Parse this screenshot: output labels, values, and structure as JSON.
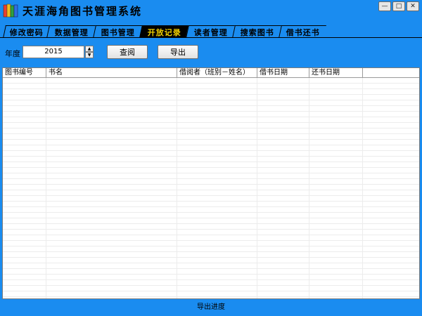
{
  "window": {
    "title": "天涯海角图书管理系统",
    "controls": [
      "minimize",
      "maximize",
      "close"
    ],
    "accent_color": "#1a8cf0"
  },
  "tabs": [
    {
      "label": "修改密码",
      "active": false
    },
    {
      "label": "数据管理",
      "active": false
    },
    {
      "label": "图书管理",
      "active": false
    },
    {
      "label": "开放记录",
      "active": true
    },
    {
      "label": "读者管理",
      "active": false
    },
    {
      "label": "搜索图书",
      "active": false
    },
    {
      "label": "借书还书",
      "active": false
    }
  ],
  "toolbar": {
    "year_label": "年度",
    "year_value": "2015",
    "query_label": "查阅",
    "export_label": "导出"
  },
  "table": {
    "columns": [
      "图书编号",
      "书名",
      "借阅者（班别－姓名）",
      "借书日期",
      "还书日期"
    ],
    "rows": []
  },
  "status": {
    "text": "导出进度"
  }
}
